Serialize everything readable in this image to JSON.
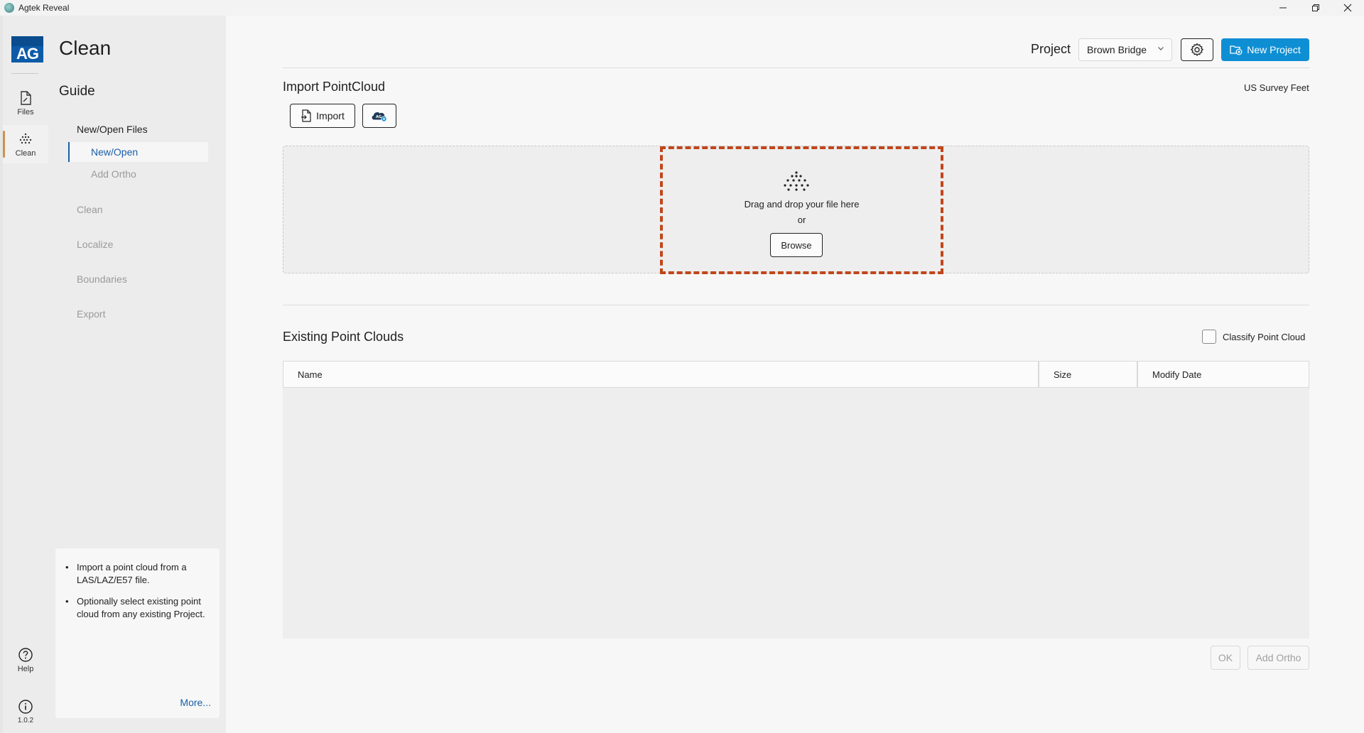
{
  "window": {
    "title": "Agtek Reveal"
  },
  "rail": {
    "logo_text": "AG",
    "items": [
      {
        "label": "Files",
        "icon": "file-icon"
      },
      {
        "label": "Clean",
        "icon": "point-cloud-icon"
      },
      {
        "label": "Help",
        "icon": "help-icon"
      },
      {
        "label": "1.0.2",
        "icon": "info-icon"
      }
    ]
  },
  "guide": {
    "title": "Clean",
    "subtitle": "Guide",
    "sections": {
      "new_open_files": "New/Open Files",
      "new_open": "New/Open",
      "add_ortho": "Add Ortho",
      "clean": "Clean",
      "localize": "Localize",
      "boundaries": "Boundaries",
      "export": "Export"
    },
    "help": {
      "bullets": [
        "Import a point cloud from a LAS/LAZ/E57 file.",
        "Optionally select existing point cloud from any existing Project."
      ],
      "more": "More..."
    }
  },
  "header": {
    "project_label": "Project",
    "project_value": "Brown Bridge",
    "new_project": "New Project"
  },
  "import": {
    "title": "Import PointCloud",
    "units": "US Survey Feet",
    "import_button": "Import",
    "drop_text": "Drag and drop your file here",
    "or_text": "or",
    "browse": "Browse"
  },
  "existing": {
    "title": "Existing Point Clouds",
    "classify_label": "Classify Point Cloud",
    "classify_checked": false,
    "columns": [
      "Name",
      "Size",
      "Modify Date"
    ],
    "rows": []
  },
  "footer": {
    "ok": "OK",
    "add_ortho": "Add Ortho"
  },
  "colors": {
    "accent": "#0e8fd4",
    "link": "#1a5fa8",
    "drop_highlight": "#c0461b",
    "logo": "#0d5ba8"
  }
}
